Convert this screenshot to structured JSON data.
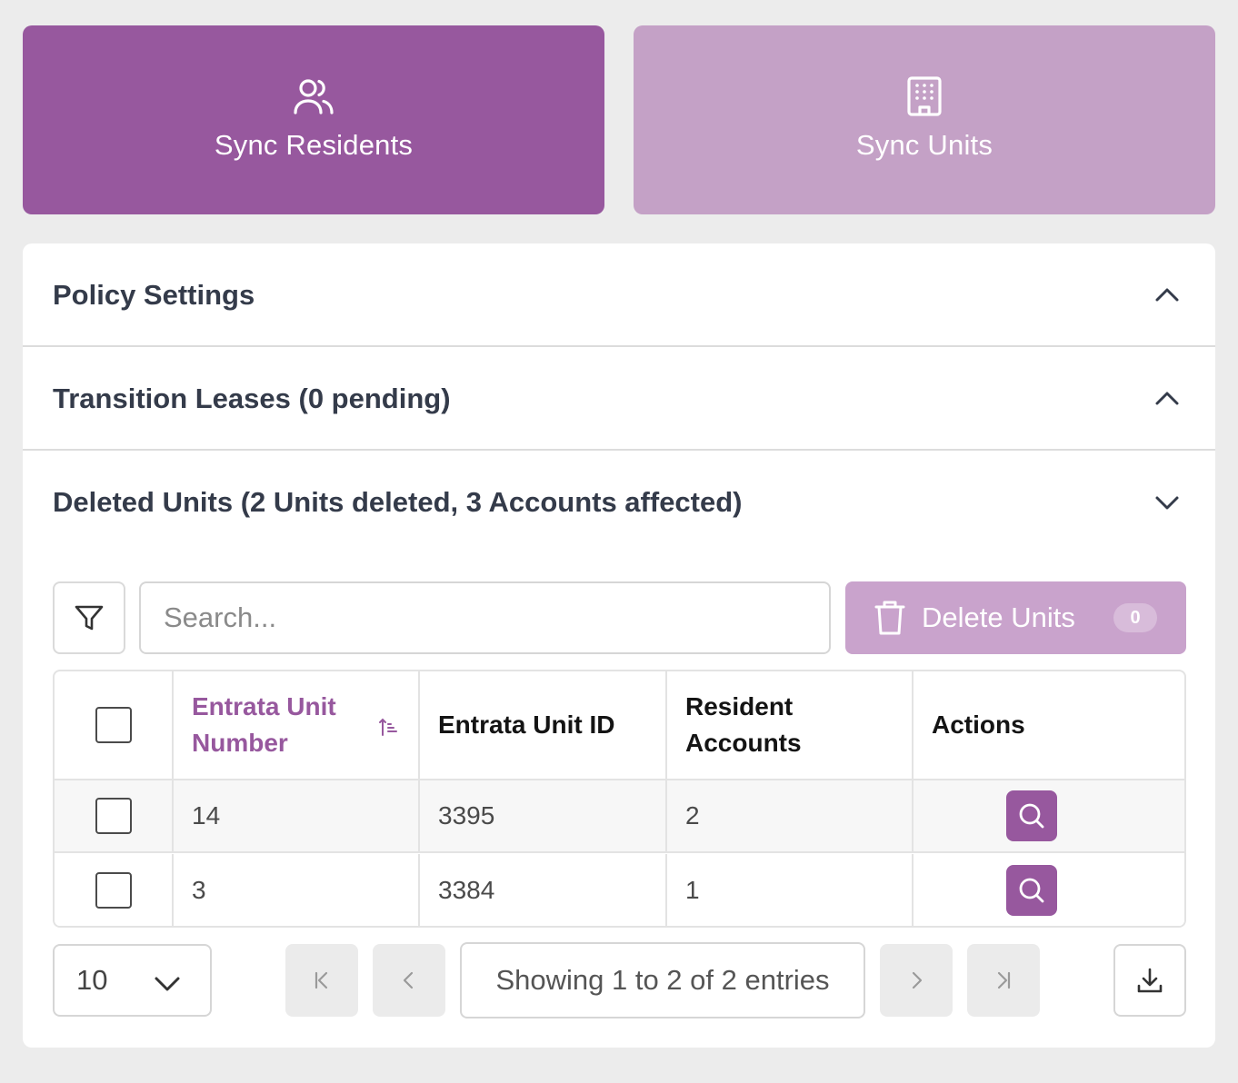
{
  "sync": {
    "residents": {
      "label": "Sync Residents",
      "icon": "users-icon"
    },
    "units": {
      "label": "Sync Units",
      "icon": "building-icon"
    }
  },
  "colors": {
    "primary": "#97589e",
    "primary_light": "#c4a1c6",
    "disabled": "#c9a3cc"
  },
  "accordions": [
    {
      "title": "Policy Settings",
      "expanded": false
    },
    {
      "title": "Transition Leases (0 pending)",
      "expanded": false
    },
    {
      "title": "Deleted Units (2 Units deleted, 3 Accounts affected)",
      "expanded": true
    }
  ],
  "toolbar": {
    "search_placeholder": "Search...",
    "delete_label": "Delete Units",
    "delete_count": "0"
  },
  "table": {
    "headers": [
      "Entrata Unit Number",
      "Entrata Unit ID",
      "Resident Accounts",
      "Actions"
    ],
    "rows": [
      {
        "unit_number": "14",
        "unit_id": "3395",
        "accounts": "2"
      },
      {
        "unit_number": "3",
        "unit_id": "3384",
        "accounts": "1"
      }
    ]
  },
  "pagination": {
    "page_size": "10",
    "info": "Showing 1 to 2 of 2 entries"
  }
}
